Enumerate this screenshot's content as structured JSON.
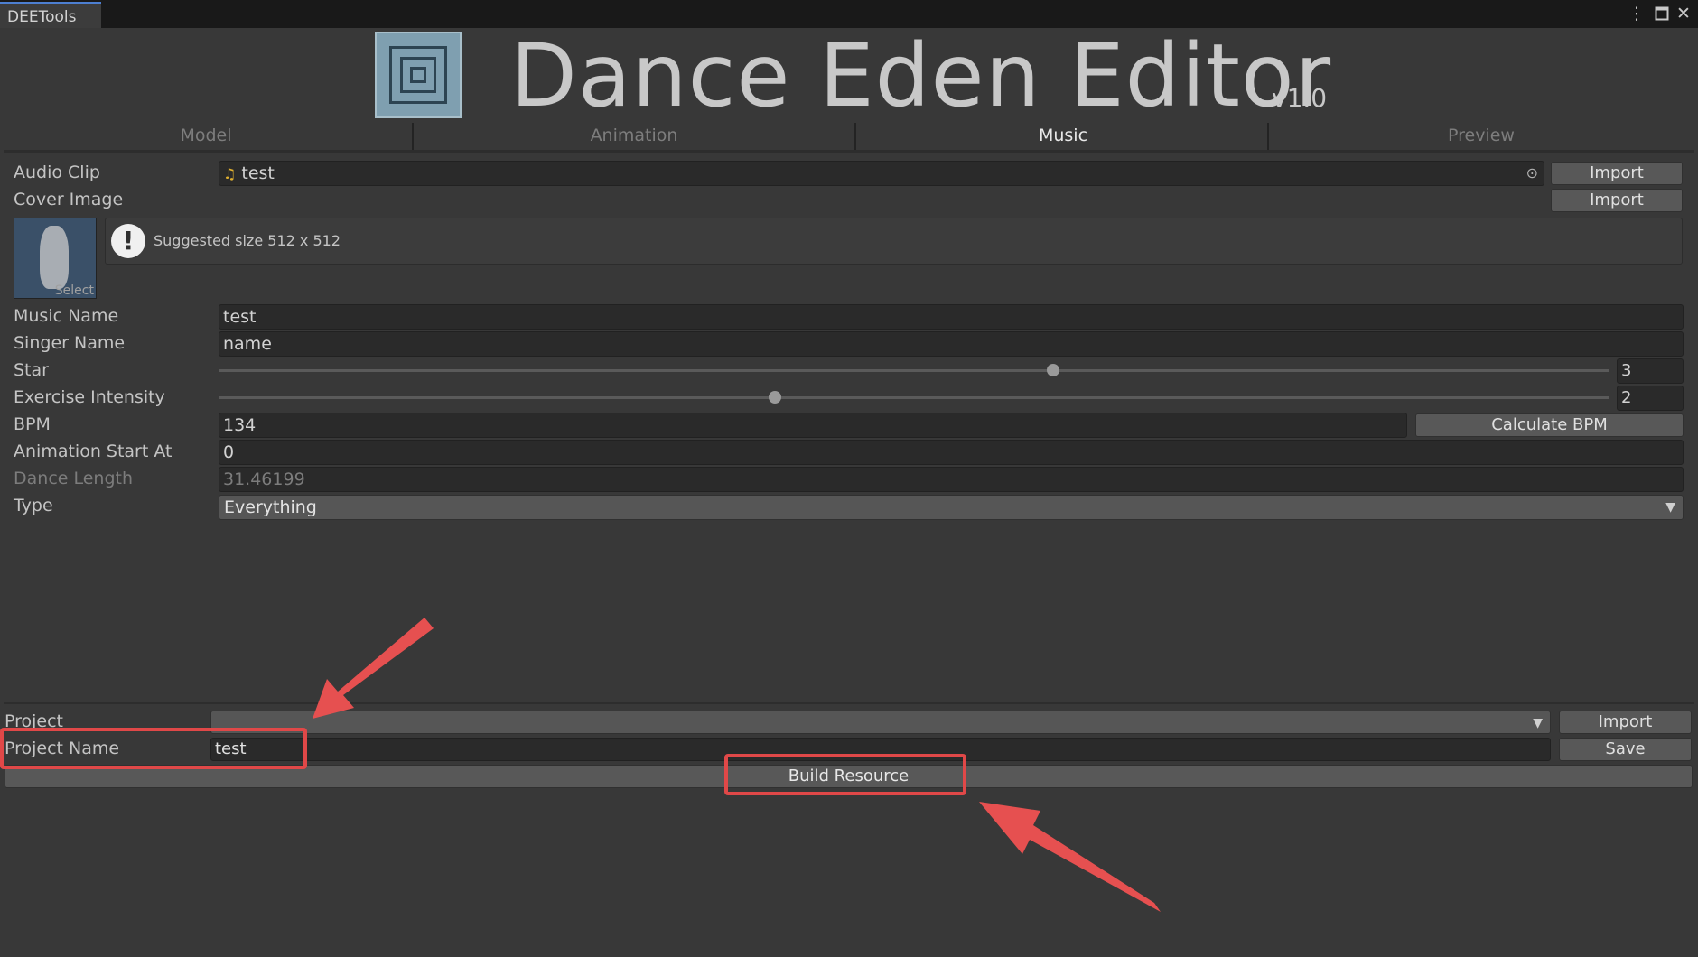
{
  "window": {
    "tab_title": "DEETools",
    "icons": [
      "more-vert-icon",
      "maximize-icon",
      "close-icon"
    ]
  },
  "header": {
    "title": "Dance Eden Editor",
    "version": "v1.0",
    "logo_icon": "qr-logo-icon"
  },
  "main_tabs": [
    {
      "label": "Model",
      "active": false
    },
    {
      "label": "Animation",
      "active": false
    },
    {
      "label": "Music",
      "active": true
    },
    {
      "label": "Preview",
      "active": false
    }
  ],
  "form": {
    "audio_clip": {
      "label": "Audio Clip",
      "value": "test",
      "icon": "music-note-icon",
      "picker_icon": "object-picker-icon",
      "button": "Import"
    },
    "cover_image": {
      "label": "Cover Image",
      "button": "Import",
      "select_label": "Select",
      "help_text": "Suggested size 512 x 512",
      "help_icon": "warning-icon"
    },
    "music_name": {
      "label": "Music Name",
      "value": "test"
    },
    "singer_name": {
      "label": "Singer Name",
      "value": "name"
    },
    "star": {
      "label": "Star",
      "value": "3",
      "max": 5,
      "min": 0
    },
    "exercise_intensity": {
      "label": "Exercise Intensity",
      "value": "2",
      "max": 5,
      "min": 0
    },
    "bpm": {
      "label": "BPM",
      "value": "134",
      "button": "Calculate BPM"
    },
    "animation_start": {
      "label": "Animation Start At",
      "value": "0"
    },
    "dance_length": {
      "label": "Dance Length",
      "value": "31.46199"
    },
    "type": {
      "label": "Type",
      "value": "Everything"
    }
  },
  "project": {
    "label": "Project",
    "value": "",
    "import_button": "Import",
    "name_label": "Project Name",
    "name_value": "test",
    "save_button": "Save",
    "build_button": "Build Resource"
  },
  "colors": {
    "annotation": "#e04848",
    "background": "#383838"
  }
}
